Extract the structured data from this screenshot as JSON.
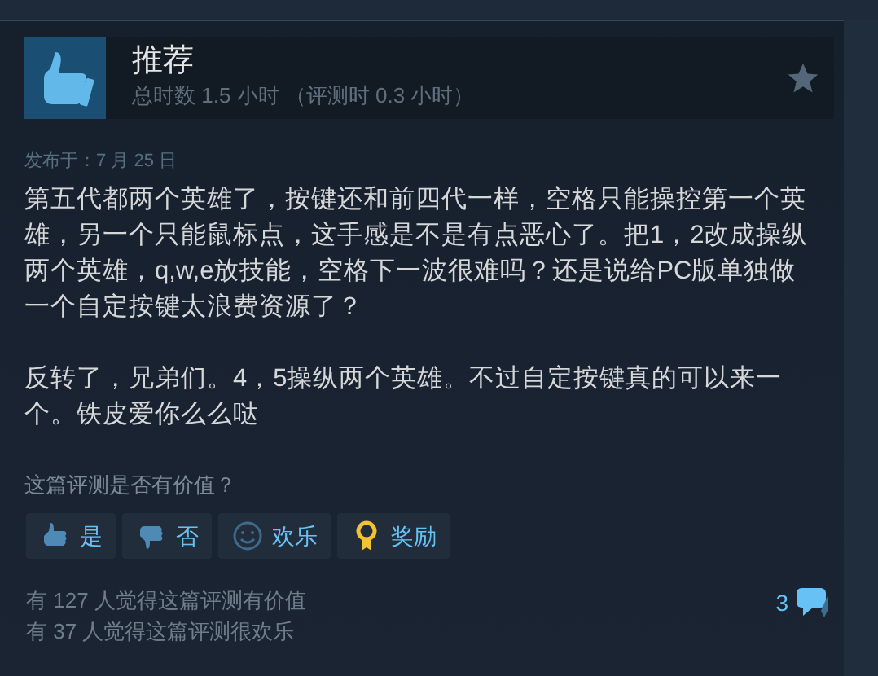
{
  "review": {
    "verdict": "推荐",
    "hours": "总时数 1.5 小时 （评测时 0.3 小时）",
    "posted": "发布于：7 月 25 日",
    "paragraphs": [
      "第五代都两个英雄了，按键还和前四代一样，空格只能操控第一个英雄，另一个只能鼠标点，这手感是不是有点恶心了。把1，2改成操纵两个英雄，q,w,e放技能，空格下一波很难吗？还是说给PC版单独做一个自定按键太浪费资源了？",
      "反转了，兄弟们。4，5操纵两个英雄。不过自定按键真的可以来一个。铁皮爱你么么哒"
    ]
  },
  "feedback": {
    "question": "这篇评测是否有价值？",
    "buttons": [
      {
        "kind": "yes",
        "label": "是"
      },
      {
        "kind": "no",
        "label": "否"
      },
      {
        "kind": "funny",
        "label": "欢乐"
      },
      {
        "kind": "award",
        "label": "奖励"
      }
    ],
    "stats": [
      "有 127 人觉得这篇评测有价值",
      "有 37 人觉得这篇评测很欢乐"
    ],
    "comments": "3"
  }
}
